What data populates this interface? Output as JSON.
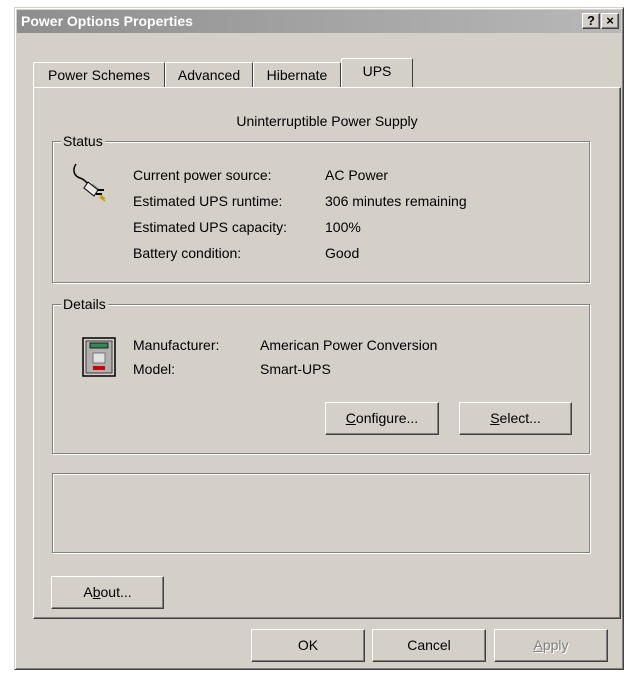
{
  "window": {
    "title": "Power Options Properties",
    "help_button": "?",
    "close_button": "×"
  },
  "tabs": [
    {
      "label": "Power Schemes",
      "active": false
    },
    {
      "label": "Advanced",
      "active": false
    },
    {
      "label": "Hibernate",
      "active": false
    },
    {
      "label": "UPS",
      "active": true
    }
  ],
  "panel": {
    "heading": "Uninterruptible Power Supply",
    "status": {
      "legend": "Status",
      "icon": "power-plug-icon",
      "rows": [
        {
          "label": "Current power source:",
          "value": "AC Power"
        },
        {
          "label": "Estimated UPS runtime:",
          "value": "306 minutes remaining"
        },
        {
          "label": "Estimated UPS capacity:",
          "value": "100%"
        },
        {
          "label": "Battery condition:",
          "value": "Good"
        }
      ]
    },
    "details": {
      "legend": "Details",
      "icon": "ups-device-icon",
      "rows": [
        {
          "label": "Manufacturer:",
          "value": "American Power Conversion"
        },
        {
          "label": "Model:",
          "value": "Smart-UPS"
        }
      ],
      "configure_button": {
        "prefix": "",
        "underlined": "C",
        "rest": "onfigure..."
      },
      "select_button": {
        "prefix": "",
        "underlined": "S",
        "rest": "elect..."
      }
    },
    "about_button": {
      "prefix": "A",
      "underlined": "b",
      "rest": "out..."
    }
  },
  "footer": {
    "ok_label": "OK",
    "cancel_label": "Cancel",
    "apply": {
      "prefix": "",
      "underlined": "A",
      "rest": "pply",
      "disabled": true
    }
  }
}
